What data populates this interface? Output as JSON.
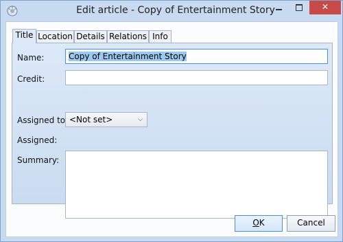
{
  "window": {
    "title": "Edit article - Copy of Entertainment Story",
    "icon": "app-icon",
    "controls": {
      "minimize_icon": "minimize-icon",
      "maximize_icon": "maximize-icon",
      "close_label": "✕"
    },
    "accent_close": "#c74a48"
  },
  "tabs": [
    {
      "label": "Title",
      "active": true
    },
    {
      "label": "Location",
      "active": false
    },
    {
      "label": "Details",
      "active": false
    },
    {
      "label": "Relations",
      "active": false
    },
    {
      "label": "Info",
      "active": false
    }
  ],
  "form": {
    "name_label": "Name:",
    "name_value": "Copy of Entertainment Story",
    "credit_label": "Credit:",
    "credit_value": "",
    "assigned_to_label": "Assigned to:",
    "assigned_to_value": "<Not set>",
    "assigned_label": "Assigned:",
    "summary_label": "Summary:",
    "summary_value": ""
  },
  "buttons": {
    "ok_label": "OK",
    "ok_underline": "O",
    "ok_rest": "K",
    "cancel_label": "Cancel"
  }
}
